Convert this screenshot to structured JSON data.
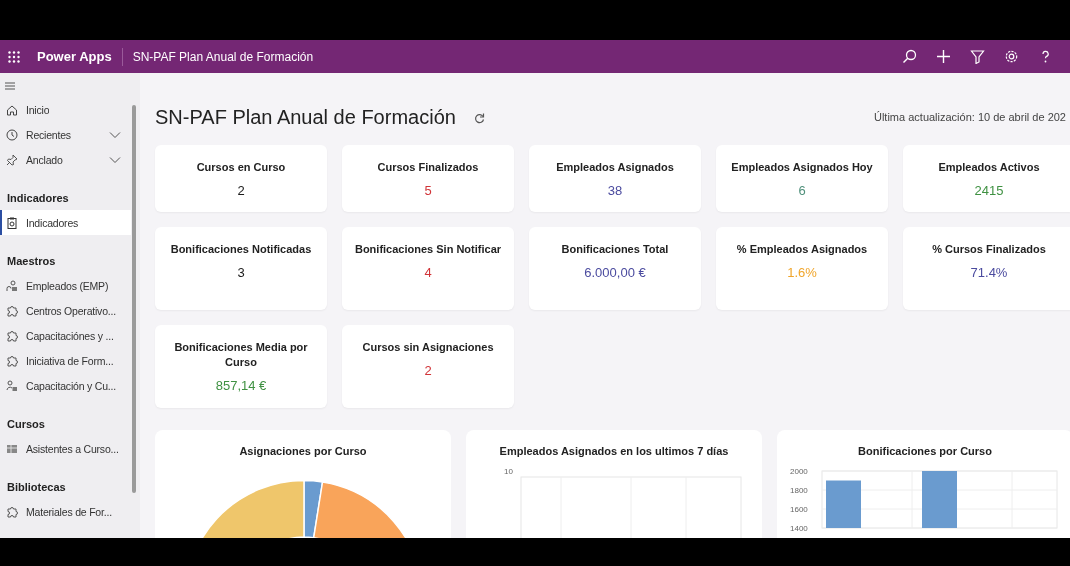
{
  "app_bar": {
    "app_name": "Power Apps",
    "app_title": "SN-PAF Plan Anual de Formación"
  },
  "sidebar": {
    "groups": [
      {
        "items": [
          {
            "label": "Inicio",
            "kind": "home",
            "expandable": false,
            "selected": false
          },
          {
            "label": "Recientes",
            "kind": "clock",
            "expandable": true,
            "selected": false
          },
          {
            "label": "Anclado",
            "kind": "pin",
            "expandable": true,
            "selected": false
          }
        ]
      },
      {
        "heading": "Indicadores",
        "items": [
          {
            "label": "Indicadores",
            "kind": "dashboard",
            "expandable": false,
            "selected": true
          }
        ]
      },
      {
        "heading": "Maestros",
        "items": [
          {
            "label": "Empleados (EMP)",
            "kind": "people",
            "expandable": false,
            "selected": false
          },
          {
            "label": "Centros Operativo...",
            "kind": "puzzle",
            "expandable": false,
            "selected": false
          },
          {
            "label": "Capacitaciónes y ...",
            "kind": "puzzle",
            "expandable": false,
            "selected": false
          },
          {
            "label": "Iniciativa de Form...",
            "kind": "puzzle",
            "expandable": false,
            "selected": false
          },
          {
            "label": "Capacitación y Cu...",
            "kind": "person",
            "expandable": false,
            "selected": false
          }
        ]
      },
      {
        "heading": "Cursos",
        "items": [
          {
            "label": "Asistentes a Curso...",
            "kind": "table",
            "expandable": false,
            "selected": false
          }
        ]
      },
      {
        "heading": "Bibliotecas",
        "items": [
          {
            "label": "Materiales de For...",
            "kind": "puzzle",
            "expandable": false,
            "selected": false
          }
        ]
      }
    ]
  },
  "page": {
    "title": "SN-PAF Plan Anual de Formación",
    "last_updated": "Última actualización: 10 de abril de 202"
  },
  "cards": [
    {
      "title": "Cursos en Curso",
      "value": "2",
      "color": "#1b1b1b"
    },
    {
      "title": "Cursos Finalizados",
      "value": "5",
      "color": "#d13438"
    },
    {
      "title": "Empleados Asignados",
      "value": "38",
      "color": "#4b4b9f"
    },
    {
      "title": "Empleados Asignados Hoy",
      "value": "6",
      "color": "#4e8f7a"
    },
    {
      "title": "Empleados Activos",
      "value": "2415",
      "color": "#3f9142"
    },
    {
      "title": "Bonificaciones Notificadas",
      "value": "3",
      "color": "#1b1b1b"
    },
    {
      "title": "Bonificaciones Sin Notificar",
      "value": "4",
      "color": "#d13438"
    },
    {
      "title": "Bonificaciones Total",
      "value": "6.000,00 €",
      "color": "#4b4b9f"
    },
    {
      "title": "% Empleados Asignados",
      "value": "1.6%",
      "color": "#f0a52a"
    },
    {
      "title": "% Cursos Finalizados",
      "value": "71.4%",
      "color": "#4b4b9f"
    },
    {
      "title": "Bonificaciones Media por Curso",
      "value": "857,14 €",
      "color": "#3f9142"
    },
    {
      "title": "Cursos sin Asignaciones",
      "value": "2",
      "color": "#d13438"
    }
  ],
  "charts": [
    {
      "kind": "donut",
      "title": "Asignaciones por Curso"
    },
    {
      "kind": "line",
      "title": "Empleados Asignados en los ultimos 7 días",
      "y_tick_label": "10"
    },
    {
      "kind": "bar",
      "chart_data": {
        "type": "bar",
        "title": "Bonificaciones por Curso",
        "series": [
          {
            "color": "#6a9bcf",
            "values": [
              1900,
              2000
            ]
          }
        ],
        "yticks": [
          1400,
          1600,
          1800,
          2000
        ],
        "ylim": [
          1400,
          2000
        ]
      }
    }
  ]
}
